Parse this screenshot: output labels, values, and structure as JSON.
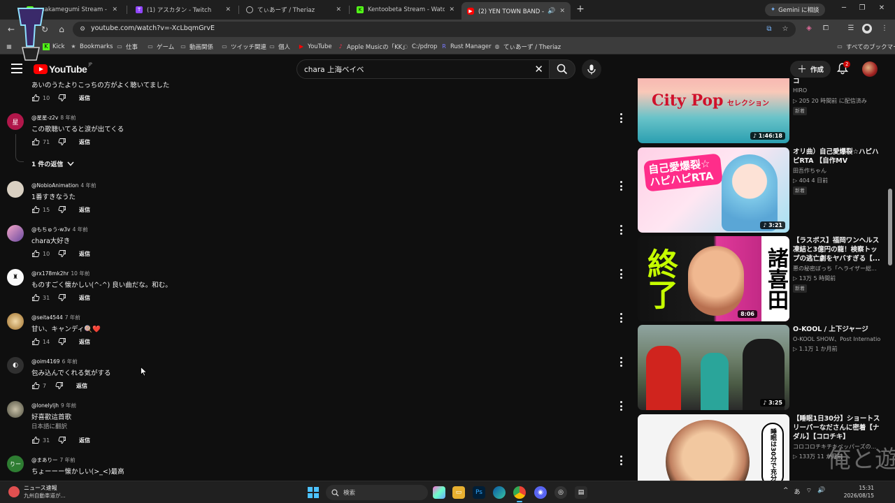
{
  "browser": {
    "tabs": [
      {
        "title": "saakamegumi Stream - Watch",
        "icon": "kick-icon",
        "color": "#53fc18"
      },
      {
        "title": "(1) アスカタン - Twitch",
        "icon": "twitch-icon",
        "color": "#9146ff"
      },
      {
        "title": "てぃあーず / Theriaz",
        "icon": "globe-icon",
        "color": "#bdbdbd"
      },
      {
        "title": "Kentoobeta Stream - Watch Li",
        "icon": "kick-icon",
        "color": "#53fc18"
      },
      {
        "title": "(2) YEN TOWN BAND - 上海",
        "icon": "youtube-icon",
        "color": "#ff0000"
      }
    ],
    "gemini_label": "Gemini に相談",
    "url": "youtube.com/watch?v=-XcLbqmGrvE",
    "bookmarks": [
      "Kick",
      "Bookmarks",
      "仕事",
      "ゲーム",
      "動画関係",
      "ツイッチ関連",
      "個人",
      "YouTube",
      "Apple Musicの「KK」",
      "C:/pdrop",
      "Rust Manager",
      "てぃあーず / Theriaz"
    ],
    "all_bookmarks": "すべてのブックマーク"
  },
  "youtube": {
    "logo_text": "YouTube",
    "country": "JP",
    "search_query": "chara 上海ベイベ",
    "create_label": "作成",
    "notif_count": "2"
  },
  "comments": [
    {
      "author": "",
      "time": "",
      "text": "あいのうたよりこっちの方がよく聴いてました",
      "likes": "10",
      "reply": "返信"
    },
    {
      "author": "@星星-z2v",
      "time": "8 年前",
      "text": "この歌聴いてると涙が出てくる",
      "likes": "71",
      "reply": "返信",
      "avatar_char": "星"
    },
    {
      "author": "@NobioAnimation",
      "time": "4 年前",
      "text": "1番すきなうた",
      "likes": "15",
      "reply": "返信"
    },
    {
      "author": "@もちゅう-w3v",
      "time": "4 年前",
      "text": "chara大好き",
      "likes": "10",
      "reply": "返信"
    },
    {
      "author": "@rx178mk2hr",
      "time": "10 年前",
      "text": "ものすごく懐かしい(^-^) 良い曲だな。和む。",
      "likes": "31",
      "reply": "返信"
    },
    {
      "author": "@seita4544",
      "time": "7 年前",
      "text": "甘い、キャンディ🍭❤️",
      "likes": "14",
      "reply": "返信"
    },
    {
      "author": "@oim4169",
      "time": "6 年前",
      "text": "包み込んでくれる気がする",
      "likes": "7",
      "reply": "返信"
    },
    {
      "author": "@lonelyljh",
      "time": "9 年前",
      "text": "好喜歡這首歌",
      "translate": "日本語に翻訳",
      "likes": "31",
      "reply": "返信"
    },
    {
      "author": "@まありー",
      "time": "7 年前",
      "text": "ちょーーー懐かしい(>_<)最高",
      "avatar_char": "りー"
    }
  ],
  "replies_toggle": "1 件の返信",
  "videos": [
    {
      "title": "コ",
      "channel": "HIRO",
      "views": "205",
      "age": "20 時間前 に配信済み",
      "badge": "新着",
      "duration": "1:46:18",
      "thumb_text": "City Pop",
      "thumb_sub": "セレクション"
    },
    {
      "title": "オリ曲）自己愛爆裂☆ハピハピRTA 【自作MV",
      "channel": "田吾作ちゃん",
      "views": "404",
      "age": "4 日前",
      "badge": "新着",
      "duration": "3:21",
      "thumb_text": "自己愛爆裂☆ハピハピRTA"
    },
    {
      "title": "【ラスボス】福岡ワンヘルス凍結と3億円の龍！検察トップの逃亡劇をヤバすぎる【...",
      "channel": "悪の秘密ぼっち「ヘライザー総...",
      "views": "13万",
      "age": "5 時間前",
      "badge": "新着",
      "duration": "8:06",
      "thumb_text": "終了",
      "thumb_text2": "諸喜田"
    },
    {
      "title": "O-KOOL / 上下ジャージ",
      "channel": "O-KOOL SHOW、Post International",
      "views": "1.1万",
      "age": "1 か月前",
      "duration": "3:25"
    },
    {
      "title": "【睡眠1日30分】ショートスリーパーなださんに密着【ナダル】【コロチキ】",
      "channel": "コロコロチキチキペッパーズの...",
      "views": "133万",
      "age": "11 か月前",
      "thumb_text": "睡眠は30分で充分"
    }
  ],
  "taskbar": {
    "news_title": "ニュース速報",
    "news_sub": "九州自動車道が...",
    "search_label": "検索",
    "ime": "あ",
    "time": "15:31",
    "date": "2026/08/15"
  },
  "overlay": {
    "watermark": "俺と遊ぼ"
  },
  "colors": {
    "yt_red": "#ff0000",
    "bg": "#0f0f0f",
    "chrome_bg": "#3c3c3c"
  }
}
